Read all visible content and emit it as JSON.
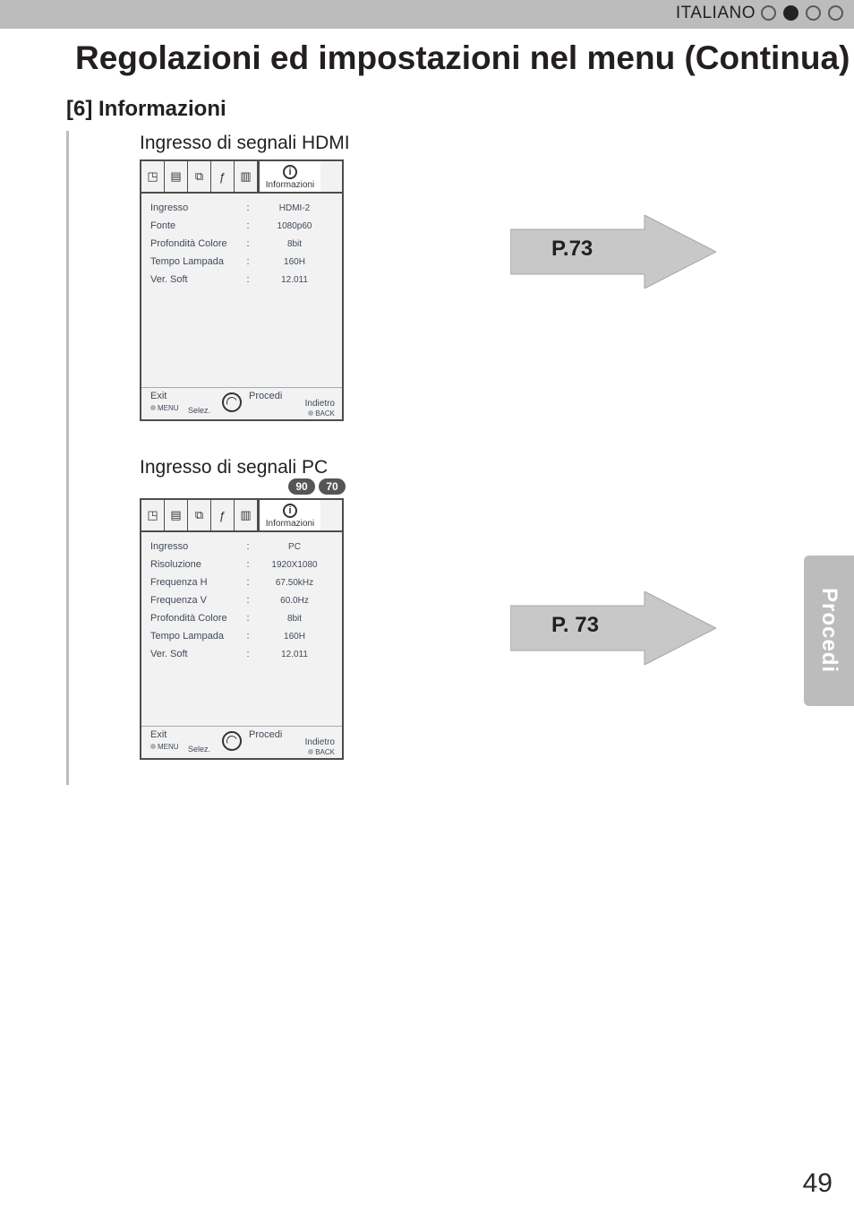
{
  "header": {
    "language": "ITALIANO",
    "dot_pattern": [
      "o",
      "f",
      "o",
      "o"
    ]
  },
  "title": "Regolazioni ed impostazioni nel menu (Continua)",
  "section_heading": "[6] Informazioni",
  "hdmi": {
    "subtitle": "Ingresso di segnali HDMI",
    "tab_active_label": "Informazioni",
    "rows": [
      {
        "label": "Ingresso",
        "value": "HDMI-2"
      },
      {
        "label": "Fonte",
        "value": "1080p60"
      },
      {
        "label": "Profondità Colore",
        "value": "8bit"
      },
      {
        "label": "Tempo Lampada",
        "value": "160H"
      },
      {
        "label": "Ver. Soft",
        "value": "12.011"
      }
    ],
    "foot": {
      "exit": "Exit",
      "menu": "MENU",
      "selez": "Selez.",
      "procedi": "Procedi",
      "indietro": "Indietro",
      "back": "BACK"
    },
    "page_ref": "P.73"
  },
  "pc": {
    "subtitle": "Ingresso di segnali PC",
    "badges": [
      "90",
      "70"
    ],
    "tab_active_label": "Informazioni",
    "rows": [
      {
        "label": "Ingresso",
        "value": "PC"
      },
      {
        "label": "Risoluzione",
        "value": "1920X1080"
      },
      {
        "label": "Frequenza H",
        "value": "67.50kHz"
      },
      {
        "label": "Frequenza V",
        "value": "60.0Hz"
      },
      {
        "label": "Profondità Colore",
        "value": "8bit"
      },
      {
        "label": "Tempo Lampada",
        "value": "160H"
      },
      {
        "label": "Ver. Soft",
        "value": "12.011"
      }
    ],
    "foot": {
      "exit": "Exit",
      "menu": "MENU",
      "selez": "Selez.",
      "procedi": "Procedi",
      "indietro": "Indietro",
      "back": "BACK"
    },
    "page_ref": "P. 73"
  },
  "side_tab": "Procedi",
  "page_number": "49",
  "icons": {
    "info": "i"
  }
}
